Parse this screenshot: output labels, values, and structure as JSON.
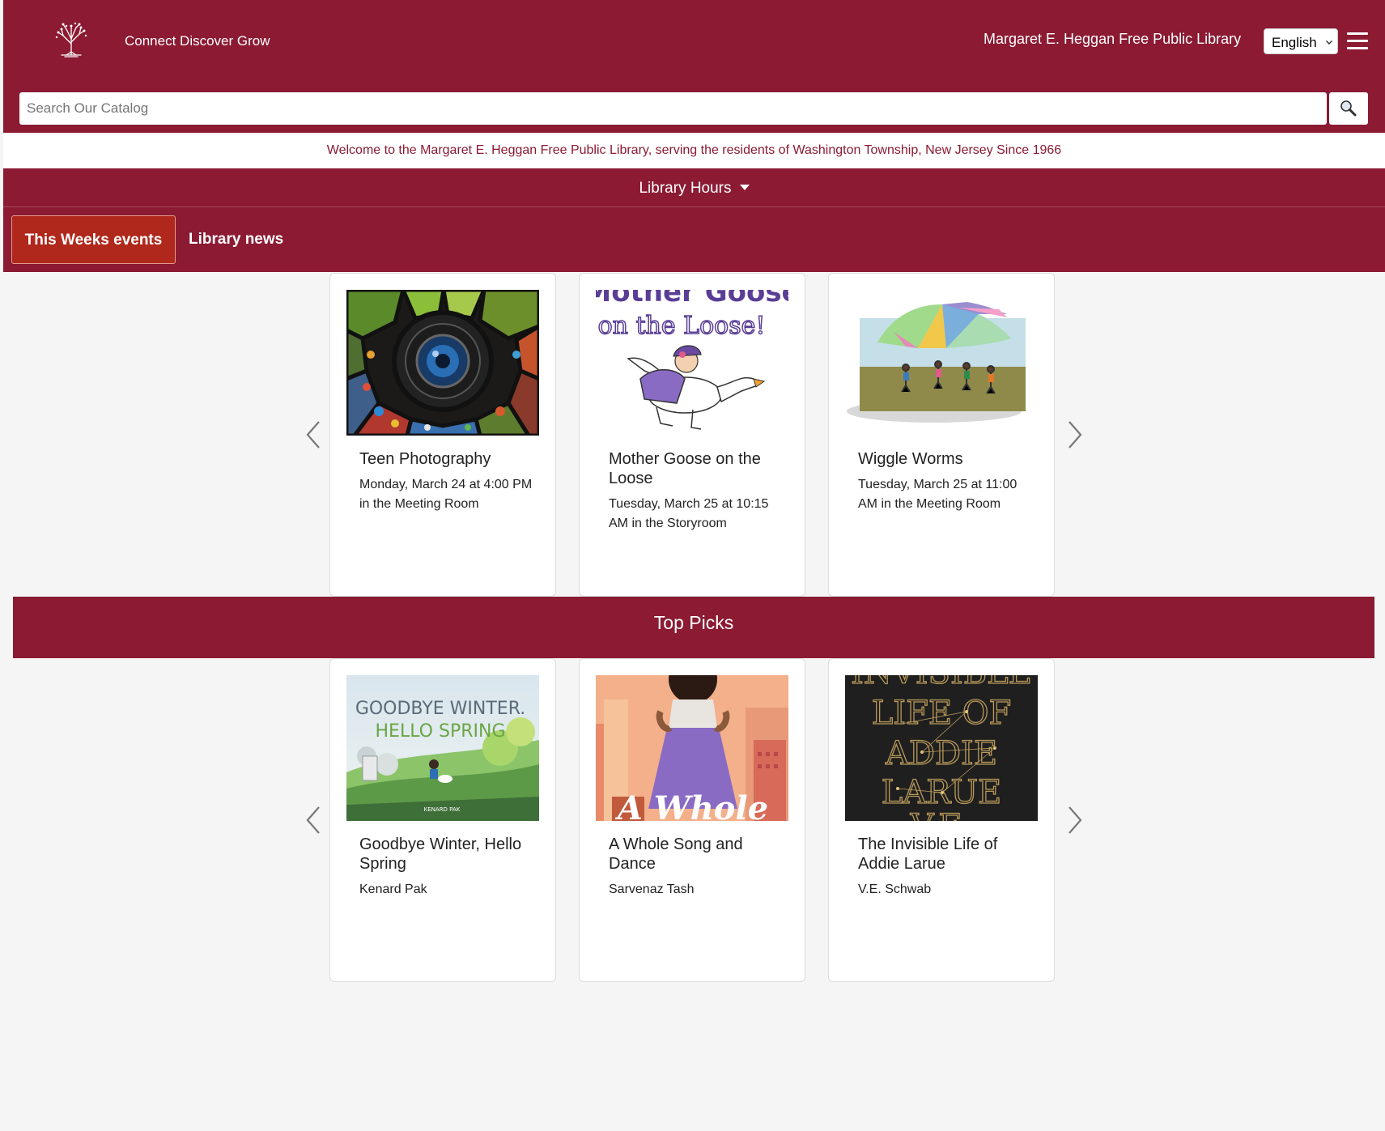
{
  "header": {
    "tagline": "Connect Discover Grow",
    "library_name": "Margaret E. Heggan Free Public Library",
    "language": "English",
    "brand_color": "#8b1a32"
  },
  "search": {
    "placeholder": "Search Our Catalog"
  },
  "welcome": "Welcome to the Margaret E. Heggan Free Public Library, serving the residents of Washington Township, New Jersey Since 1966",
  "hours": {
    "label": "Library Hours"
  },
  "tabs": [
    {
      "label": "This Weeks events",
      "active": true
    },
    {
      "label": "Library news",
      "active": false
    }
  ],
  "events": [
    {
      "title": "Teen Photography",
      "detail": "Monday, March 24 at 4:00 PM in the Meeting Room"
    },
    {
      "title": "Mother Goose on the Loose",
      "detail": "Tuesday, March 25 at 10:15 AM in the Storyroom",
      "image_text_1": "Mother Goose",
      "image_text_2": "on the Loose!"
    },
    {
      "title": "Wiggle Worms",
      "detail": "Tuesday, March 25 at 11:00 AM in the Meeting Room"
    }
  ],
  "top_picks": {
    "heading": "Top Picks",
    "items": [
      {
        "title": "Goodbye Winter, Hello Spring",
        "author": "Kenard Pak",
        "cover_line1": "GOODBYE WINTER.",
        "cover_line2": "HELLO SPRING",
        "cover_author": "KENARD PAK"
      },
      {
        "title": "A Whole Song and Dance",
        "author": "Sarvenaz Tash",
        "cover_text": "A Whole"
      },
      {
        "title": "The Invisible Life of Addie Larue",
        "author": "V.E. Schwab",
        "cover_line1": "INVISIBLE",
        "cover_line2": "LIFE OF",
        "cover_line3": "ADDIE",
        "cover_line4": "LARUE",
        "cover_line5": "V.E."
      }
    ]
  }
}
